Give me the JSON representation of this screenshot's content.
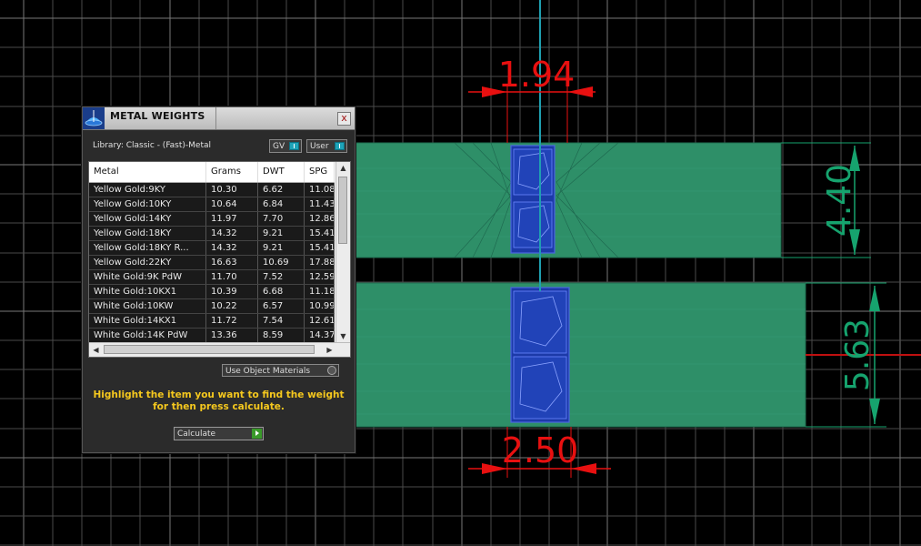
{
  "viewport": {
    "dimensions": [
      {
        "value": "1.94",
        "orientation": "horizontal"
      },
      {
        "value": "4.40",
        "orientation": "vertical"
      },
      {
        "value": "5.63",
        "orientation": "vertical"
      },
      {
        "value": "2.50",
        "orientation": "horizontal"
      }
    ],
    "colors": {
      "background": "#000000",
      "grid": "#4a4a4a",
      "model": "#2e8f68",
      "stone": "#1c3aa8",
      "dimension": "#e81010",
      "dimension_alt": "#16a36e",
      "axis": "#1f9fb0"
    }
  },
  "panel": {
    "title": "METAL WEIGHTS",
    "icon": "scale-cone-icon",
    "close_label": "x",
    "library_label": "Library: Classic - (Fast)-Metal",
    "gv_label": "GV",
    "user_label": "User",
    "table": {
      "columns": [
        "Metal",
        "Grams",
        "DWT",
        "SPG"
      ],
      "rows": [
        [
          "Yellow Gold:9KY",
          "10.30",
          "6.62",
          "11.08"
        ],
        [
          "Yellow Gold:10KY",
          "10.64",
          "6.84",
          "11.43"
        ],
        [
          "Yellow Gold:14KY",
          "11.97",
          "7.70",
          "12.86"
        ],
        [
          "Yellow Gold:18KY",
          "14.32",
          "9.21",
          "15.41"
        ],
        [
          "Yellow Gold:18KY R...",
          "14.32",
          "9.21",
          "15.41"
        ],
        [
          "Yellow Gold:22KY",
          "16.63",
          "10.69",
          "17.88"
        ],
        [
          "White Gold:9K PdW",
          "11.70",
          "7.52",
          "12.59"
        ],
        [
          "White Gold:10KX1",
          "10.39",
          "6.68",
          "11.18"
        ],
        [
          "White Gold:10KW",
          "10.22",
          "6.57",
          "10.99"
        ],
        [
          "White Gold:14KX1",
          "11.72",
          "7.54",
          "12.61"
        ],
        [
          "White Gold:14K PdW",
          "13.36",
          "8.59",
          "14.37"
        ]
      ]
    },
    "use_object_materials_label": "Use Object Materials",
    "instruction": "Highlight the item you want to find the weight for then press calculate.",
    "calculate_label": "Calculate"
  }
}
